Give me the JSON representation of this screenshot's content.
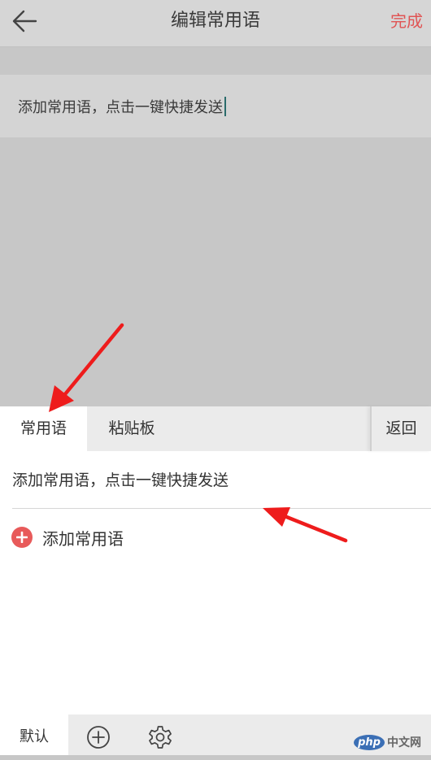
{
  "header": {
    "title": "编辑常用语",
    "done_label": "完成"
  },
  "editor": {
    "value": "添加常用语，点击一键快捷发送"
  },
  "panel": {
    "tabs": [
      {
        "label": "常用语"
      },
      {
        "label": "粘贴板"
      }
    ],
    "return_label": "返回",
    "phrases": [
      "添加常用语，点击一键快捷发送"
    ],
    "add_phrase_label": "添加常用语"
  },
  "bottombar": {
    "default_label": "默认",
    "icons": [
      "add-circle-icon",
      "settings-icon"
    ]
  },
  "watermark": {
    "logo": "php",
    "site": "中文网"
  },
  "colors": {
    "accent": "#e05454",
    "caret": "#2a6b6b",
    "annotation_arrow": "#ee1c1c"
  }
}
